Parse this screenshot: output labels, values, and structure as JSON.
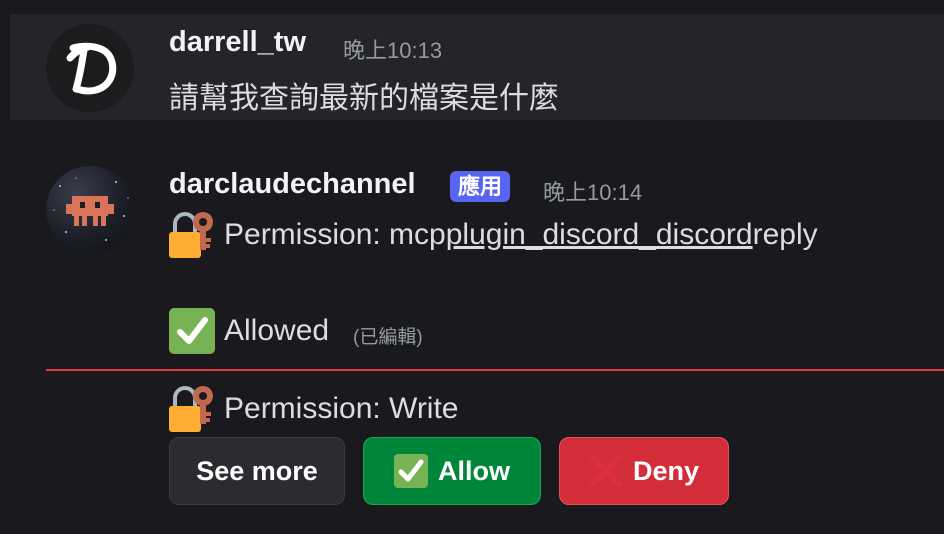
{
  "message1": {
    "username": "darrell_tw",
    "timestamp": "晚上10:13",
    "content": "請幫我查詢最新的檔案是什麼",
    "avatar_letter": "D"
  },
  "message2": {
    "username": "darclaudechannel",
    "badge": "應用",
    "timestamp": "晚上10:14",
    "permission_prefix": "Permission: mcp",
    "permission_link": "plugin_discord_discord",
    "permission_suffix": "reply",
    "status": "Allowed",
    "edited": "(已編輯)"
  },
  "message3": {
    "permission_text": "Permission: Write"
  },
  "buttons": {
    "see_more": "See more",
    "allow": "Allow",
    "deny": "Deny"
  },
  "icons": {
    "lock": "locked-with-key-icon",
    "check": "check-mark-button-icon",
    "cross": "cross-mark-icon"
  },
  "colors": {
    "badge": "#5865f2",
    "allow": "#00863a",
    "deny": "#d22d39",
    "divider": "#d83c3e"
  }
}
